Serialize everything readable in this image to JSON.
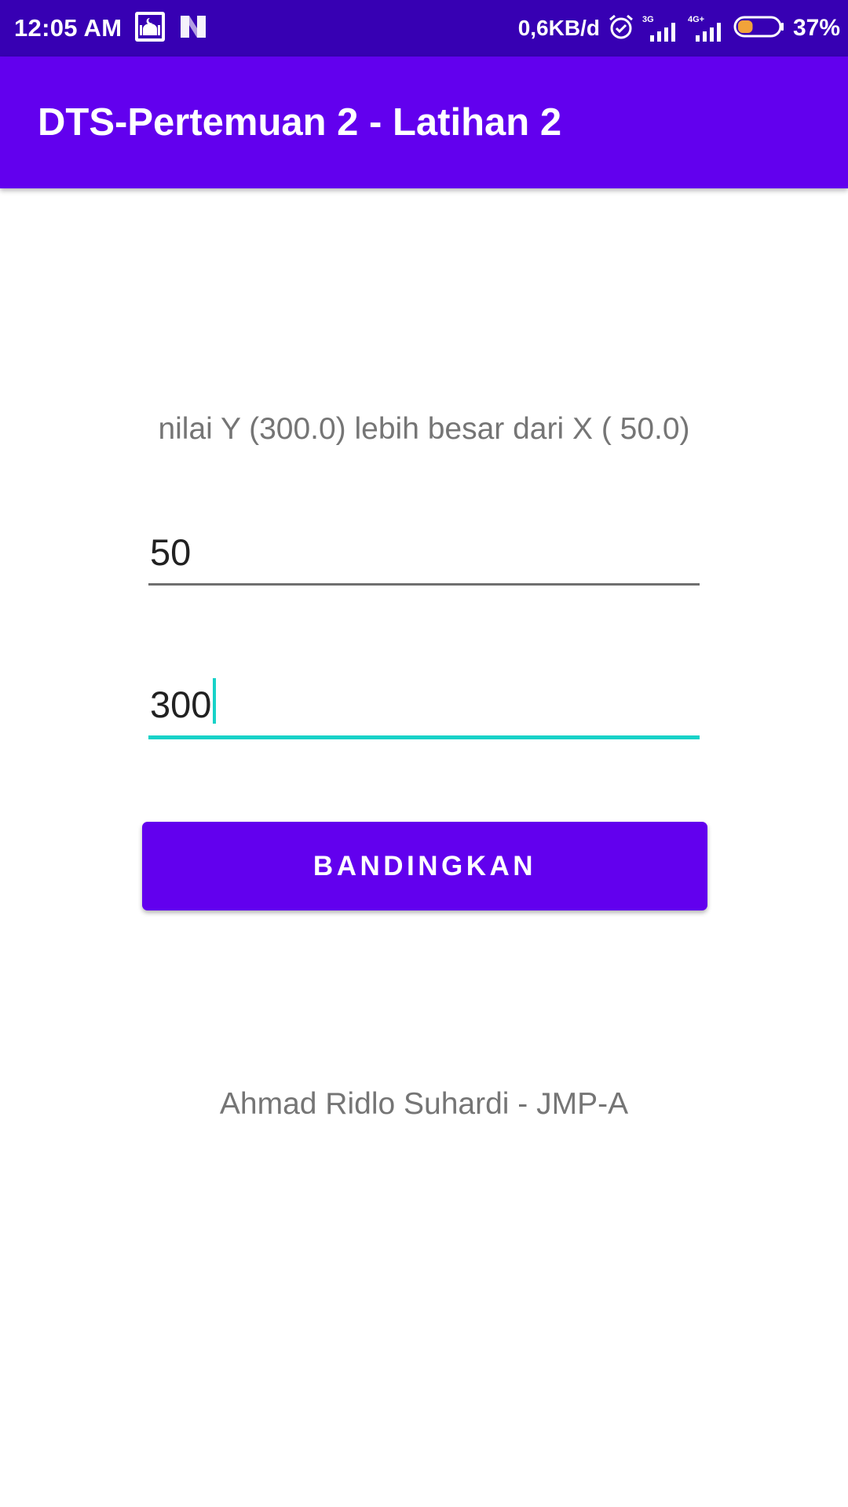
{
  "status_bar": {
    "time": "12:05 AM",
    "net_speed": "0,6KB/d",
    "sim1_type": "3G",
    "sim2_type": "4G+",
    "battery_percent": "37%",
    "battery_level": 0.37,
    "icons": [
      "mosque-app-icon",
      "n-app-icon",
      "alarm-icon",
      "signal-icon",
      "signal-icon",
      "battery-icon"
    ]
  },
  "app_bar": {
    "title": "DTS-Pertemuan 2 - Latihan 2"
  },
  "main": {
    "result_text": "nilai Y (300.0) lebih besar dari X ( 50.0)",
    "input_x": {
      "value": "50"
    },
    "input_y": {
      "value": "300"
    },
    "compare_button_label": "BANDINGKAN",
    "footer": "Ahmad Ridlo Suhardi - JMP-A"
  },
  "colors": {
    "status_bar": "#3700b3",
    "primary": "#6200ee",
    "accent": "#18d2c8",
    "secondary_text": "#757575"
  }
}
